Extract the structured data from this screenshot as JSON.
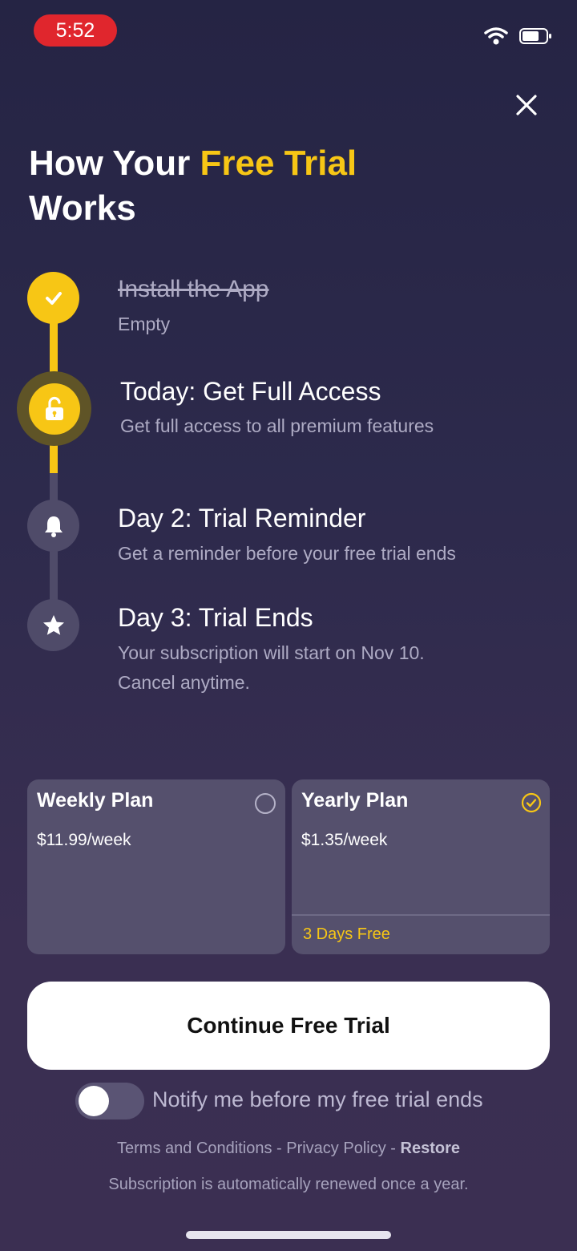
{
  "status_bar": {
    "time": "5:52"
  },
  "header": {
    "title_part1": "How Your ",
    "title_highlight": "Free Trial",
    "title_part2": "Works"
  },
  "timeline": [
    {
      "title": "Install the App",
      "description": "Empty",
      "icon": "checkmark-icon",
      "state": "completed"
    },
    {
      "title": "Today: Get Full Access",
      "description": "Get full access to all premium features",
      "icon": "unlock-icon",
      "state": "current"
    },
    {
      "title": "Day 2: Trial Reminder",
      "description": "Get a reminder before your free trial ends",
      "icon": "bell-icon",
      "state": "upcoming"
    },
    {
      "title": "Day 3: Trial Ends",
      "description_line1": "Your subscription will start on Nov 10.",
      "description_line2": "Cancel anytime.",
      "icon": "star-icon",
      "state": "upcoming"
    }
  ],
  "plans": [
    {
      "name": "Weekly Plan",
      "price": "$11.99/week",
      "selected": false
    },
    {
      "name": "Yearly Plan",
      "price": "$1.35/week",
      "badge": "3 Days Free",
      "selected": true
    }
  ],
  "cta": {
    "label": "Continue Free Trial"
  },
  "notify": {
    "label": "Notify me before my free trial ends",
    "enabled": false
  },
  "footer": {
    "terms": "Terms and Conditions",
    "privacy": "Privacy Policy",
    "restore": "Restore",
    "separator": " - ",
    "renewal_note": "Subscription is automatically renewed once a year."
  },
  "colors": {
    "accent": "#f7c615",
    "background": "#2b2848",
    "card": "#55506d",
    "time_pill": "#e0262d"
  }
}
